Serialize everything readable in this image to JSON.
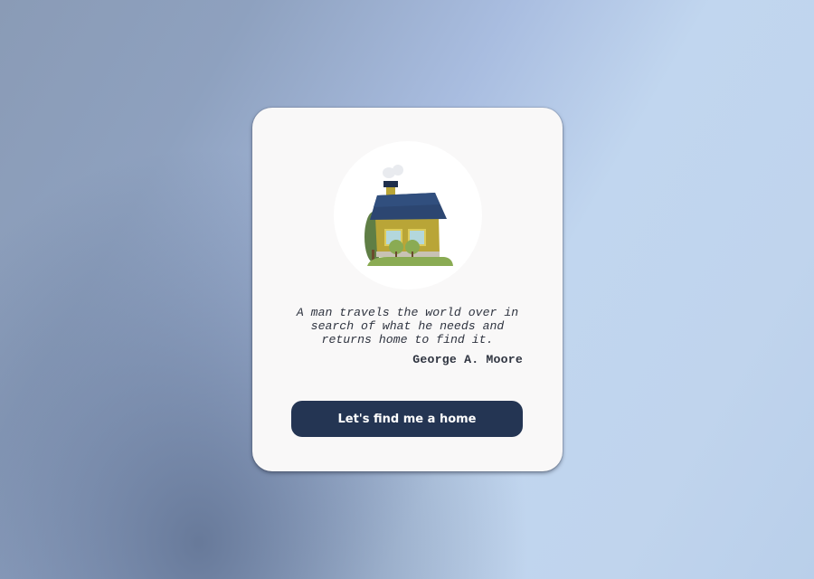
{
  "card": {
    "illustration": {
      "icon": "house-icon",
      "colors": {
        "roof": "#2c4671",
        "walls": "#b9a537",
        "tree": "#5f7e45",
        "grass": "#8aab53",
        "window": "#b3d7dc",
        "smoke": "#e9ebef"
      }
    },
    "quote": {
      "text": "A man travels the world over in search of what he needs and returns home to find it.",
      "author": "George A. Moore"
    },
    "cta": {
      "label": "Let's find me a home",
      "color": "#243553"
    }
  }
}
